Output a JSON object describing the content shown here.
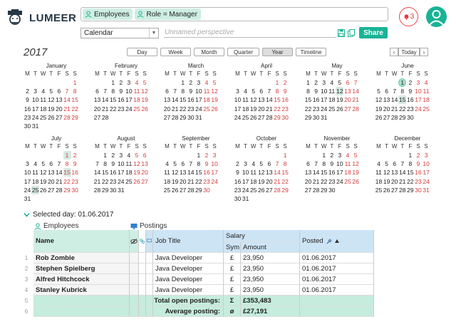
{
  "app": {
    "brand": "LUMEER"
  },
  "search": {
    "chips": [
      {
        "label": "Employees"
      },
      {
        "label": "Role = Manager"
      }
    ]
  },
  "notifications": {
    "count": "3"
  },
  "perspective": {
    "view_type": "Calendar",
    "name_placeholder": "Unnamed perspective",
    "share_label": "Share"
  },
  "calendar": {
    "year": "2017",
    "views": [
      "Day",
      "Week",
      "Month",
      "Quarter",
      "Year",
      "Timeline"
    ],
    "active_view": "Year",
    "today_label": "Today",
    "prev_glyph": "‹",
    "next_glyph": "›",
    "weekdays": [
      "M",
      "T",
      "W",
      "T",
      "F",
      "S",
      "S"
    ],
    "months": [
      {
        "name": "January",
        "offset": 6,
        "days": 31
      },
      {
        "name": "February",
        "offset": 2,
        "days": 28
      },
      {
        "name": "March",
        "offset": 2,
        "days": 31
      },
      {
        "name": "April",
        "offset": 5,
        "days": 30
      },
      {
        "name": "May",
        "offset": 0,
        "days": 31
      },
      {
        "name": "June",
        "offset": 3,
        "days": 30
      },
      {
        "name": "July",
        "offset": 5,
        "days": 31
      },
      {
        "name": "August",
        "offset": 1,
        "days": 31
      },
      {
        "name": "September",
        "offset": 4,
        "days": 30
      },
      {
        "name": "October",
        "offset": 6,
        "days": 31
      },
      {
        "name": "November",
        "offset": 2,
        "days": 30
      },
      {
        "name": "December",
        "offset": 4,
        "days": 31
      }
    ],
    "selected": {
      "month": 6,
      "day": 1
    },
    "marked_days": [
      {
        "month": 5,
        "day": 12
      },
      {
        "month": 6,
        "day": 15
      },
      {
        "month": 7,
        "day": 1
      },
      {
        "month": 7,
        "day": 15
      },
      {
        "month": 7,
        "day": 25
      }
    ]
  },
  "selected_day": {
    "label": "Selected day: 01.06.2017"
  },
  "collections": {
    "employees": "Employees",
    "postings": "Postings"
  },
  "table": {
    "headers": {
      "name": "Name",
      "job_title": "Job Title",
      "salary": "Salary",
      "sym": "Sym",
      "amount": "Amount",
      "posted": "Posted"
    },
    "rows": [
      {
        "num": "1",
        "name": "Rob Zombie",
        "job": "Java Developer",
        "sym": "£",
        "amount": "23,950",
        "posted": "01.06.2017"
      },
      {
        "num": "2",
        "name": "Stephen Spielberg",
        "job": "Java Developer",
        "sym": "£",
        "amount": "23,950",
        "posted": "01.06.2017"
      },
      {
        "num": "3",
        "name": "Alfred Hitchcock",
        "job": "Java Developer",
        "sym": "£",
        "amount": "23,950",
        "posted": "01.06.2017"
      },
      {
        "num": "4",
        "name": "Stanley Kubrick",
        "job": "Java Developer",
        "sym": "£",
        "amount": "23,950",
        "posted": "01.06.2017"
      }
    ],
    "summary": [
      {
        "num": "5",
        "label": "Total open postings:",
        "sym": "Σ",
        "value": "£353,483"
      },
      {
        "num": "6",
        "label": "Average posting:",
        "sym": "ø",
        "value": "£27,191"
      }
    ]
  },
  "colors": {
    "accent": "#18b395",
    "weekend": "#d9383a",
    "employees_bg": "#cfeee3",
    "postings_bg": "#cde4f5"
  }
}
